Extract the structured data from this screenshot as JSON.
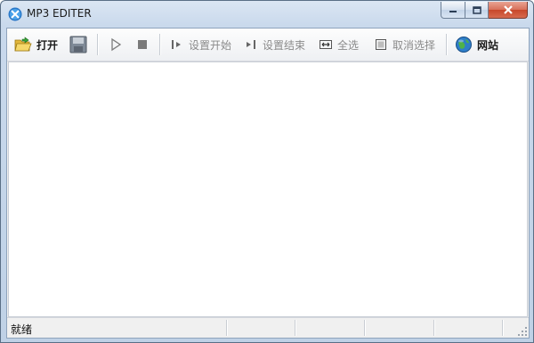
{
  "window": {
    "title": "MP3 EDITER",
    "minimize_label": "",
    "maximize_label": "",
    "close_label": ""
  },
  "toolbar": {
    "open_label": "打开",
    "set_start_label": "设置开始",
    "set_end_label": "设置结束",
    "select_all_label": "全选",
    "deselect_label": "取消选择",
    "website_label": "网站"
  },
  "statusbar": {
    "text": "就绪"
  },
  "colors": {
    "accent": "#2a6fb0",
    "close_red": "#c7472a",
    "disabled_text": "#8a8a8a"
  }
}
